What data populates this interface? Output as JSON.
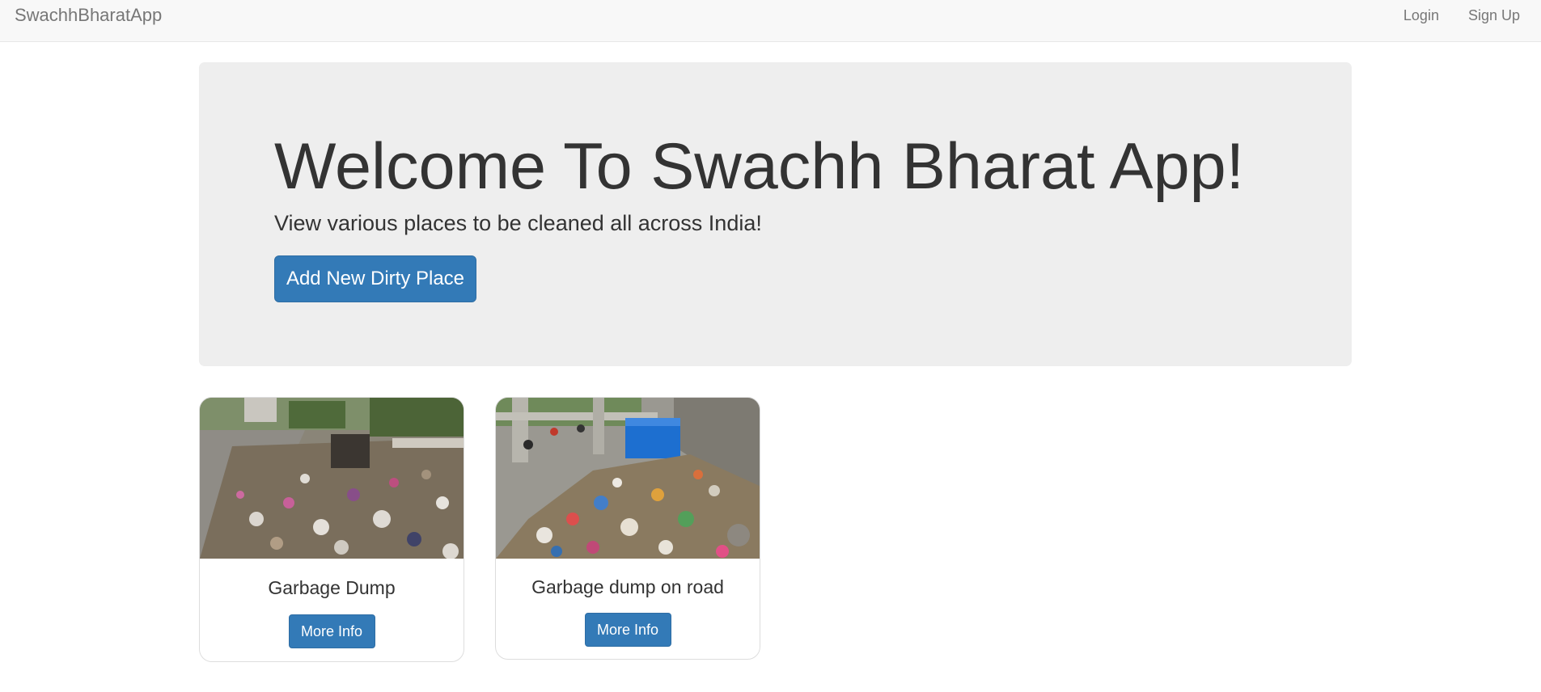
{
  "navbar": {
    "brand": "SwachhBharatApp",
    "links": [
      {
        "label": "Login"
      },
      {
        "label": "Sign Up"
      }
    ]
  },
  "jumbotron": {
    "title": "Welcome To Swachh Bharat App!",
    "subtitle": "View various places to be cleaned all across India!",
    "add_button": "Add New Dirty Place"
  },
  "places": [
    {
      "title": "Garbage Dump",
      "button": "More Info"
    },
    {
      "title": "Garbage dump on road",
      "button": "More Info"
    }
  ],
  "colors": {
    "primary": "#337ab7",
    "navbar_bg": "#f8f8f8",
    "jumbotron_bg": "#eeeeee"
  }
}
